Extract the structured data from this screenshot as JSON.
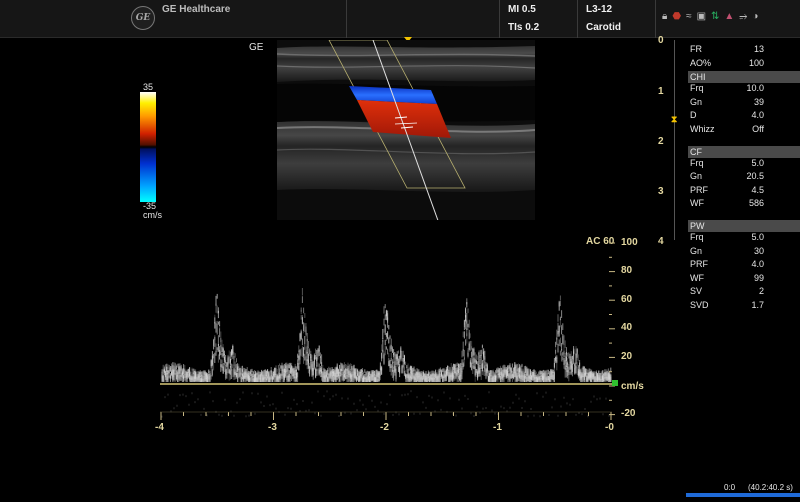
{
  "header": {
    "logo_text": "GE",
    "brand": "GE Healthcare",
    "mi": "MI 0.5",
    "tis": "TIs 0.2",
    "probe": "L3-12",
    "preset": "Carotid",
    "status_icons": [
      "lock-icon",
      "usb-icon",
      "wifi-icon",
      "network-icon",
      "transfer-icon",
      "printer-icon",
      "cable-icon",
      "brightness-icon"
    ]
  },
  "color_bar": {
    "max": "35",
    "min": "-35",
    "unit": "cm/s"
  },
  "image_label": "GE",
  "depth_scale": [
    "0",
    "1",
    "2",
    "3",
    "4"
  ],
  "params": {
    "top": [
      {
        "k": "FR",
        "v": "13"
      },
      {
        "k": "AO%",
        "v": "100"
      }
    ],
    "chi": {
      "title": "CHI",
      "rows": [
        {
          "k": "Frq",
          "v": "10.0"
        },
        {
          "k": "Gn",
          "v": "39"
        },
        {
          "k": "D",
          "v": "4.0"
        },
        {
          "k": "Whizz",
          "v": "Off"
        }
      ]
    },
    "cf": {
      "title": "CF",
      "rows": [
        {
          "k": "Frq",
          "v": "5.0"
        },
        {
          "k": "Gn",
          "v": "20.5"
        },
        {
          "k": "PRF",
          "v": "4.5"
        },
        {
          "k": "WF",
          "v": "586"
        }
      ]
    },
    "pw": {
      "title": "PW",
      "rows": [
        {
          "k": "Frq",
          "v": "5.0"
        },
        {
          "k": "Gn",
          "v": "30"
        },
        {
          "k": "PRF",
          "v": "4.0"
        },
        {
          "k": "WF",
          "v": "99"
        },
        {
          "k": "SV",
          "v": "2"
        },
        {
          "k": "SVD",
          "v": "1.7"
        }
      ]
    }
  },
  "spectrum": {
    "angle_label": "AC 60",
    "velocity_ticks": [
      "100",
      "80",
      "60",
      "40",
      "20",
      "-20"
    ],
    "unit": "cm/s",
    "time_ticks": [
      "-4",
      "-3",
      "-2",
      "-1",
      "-0"
    ]
  },
  "cine": {
    "frame": "0:0",
    "time": "(40.2:40.2 s)"
  },
  "colors": {
    "accent_label": "#e3d7a0",
    "baseline": "#d8c878",
    "cine_bar": "#1f6ad8",
    "flow_red": "#c81e0a",
    "flow_blue": "#1650ff"
  }
}
